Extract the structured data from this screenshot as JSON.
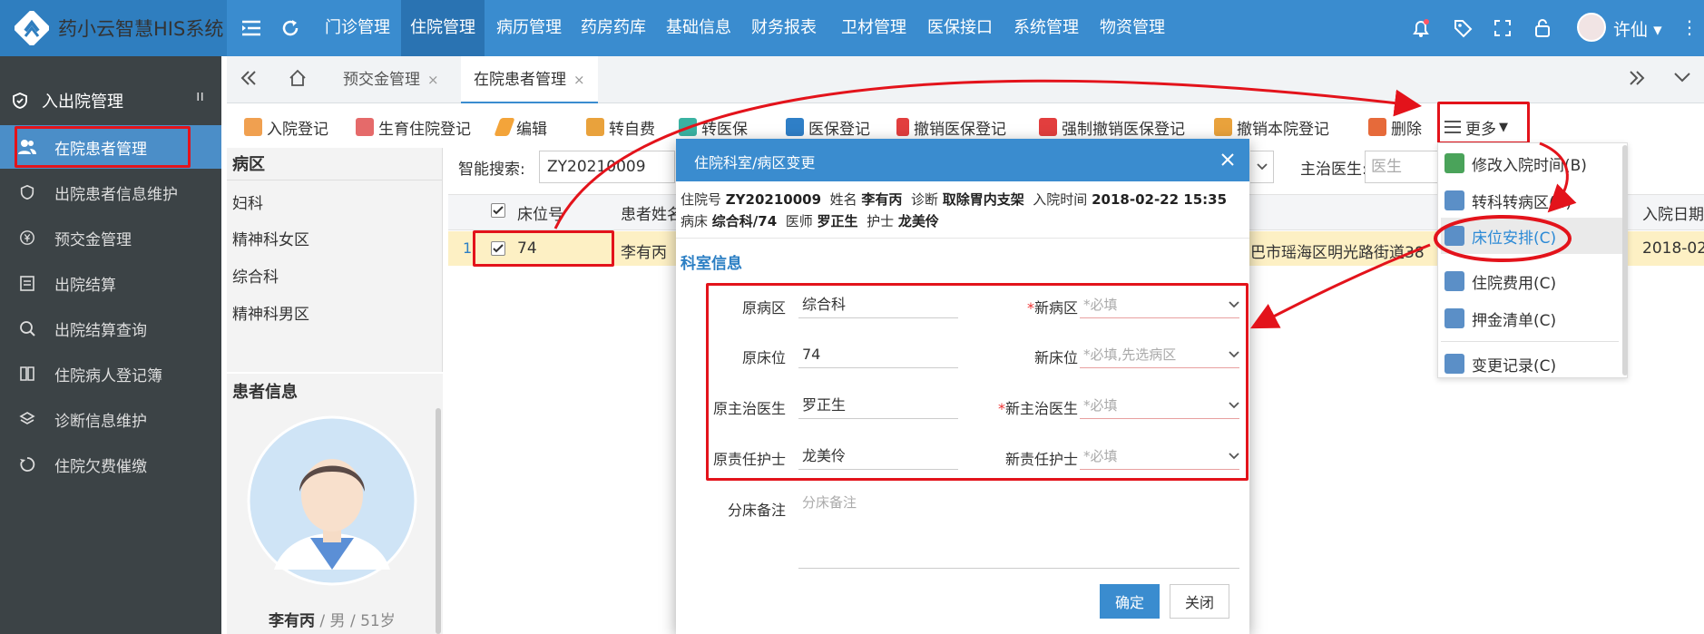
{
  "app": {
    "title": "药小云智慧HIS系统"
  },
  "nav": [
    "门诊管理",
    "住院管理",
    "病历管理",
    "药房药库",
    "基础信息",
    "财务报表",
    "卫材管理",
    "医保接口",
    "系统管理",
    "物资管理"
  ],
  "user": {
    "name": "许仙"
  },
  "sidebar": {
    "group": "入出院管理",
    "items": [
      "在院患者管理",
      "出院患者信息维护",
      "预交金管理",
      "出院结算",
      "出院结算查询",
      "住院病人登记簿",
      "诊断信息维护",
      "住院欠费催缴"
    ]
  },
  "tabs": [
    {
      "label": "预交金管理",
      "close": "×"
    },
    {
      "label": "在院患者管理",
      "close": "×"
    }
  ],
  "toolbar": [
    "入院登记",
    "生育住院登记",
    "编辑",
    "转自费",
    "转医保",
    "医保登记",
    "撤销医保登记",
    "强制撤销医保登记",
    "撤销本院登记",
    "删除",
    "更多"
  ],
  "ward": {
    "header": "病区",
    "items": [
      "妇科",
      "精神科女区",
      "综合科",
      "精神科男区"
    ]
  },
  "patient": {
    "header": "患者信息",
    "name": "李有丙",
    "sep1": " / ",
    "gender": "男",
    "sep2": " / ",
    "age": "51岁"
  },
  "search": {
    "label": "智能搜索:",
    "value": "ZY20210009",
    "doctor_label": "主治医生:",
    "doctor_placeholder": "医生"
  },
  "grid": {
    "headers": {
      "bed": "床位号",
      "name": "患者姓名",
      "admit": "入院日期"
    },
    "row": {
      "index": "1",
      "bed": "74",
      "name": "李有丙",
      "address": "巴市瑶海区明光路街道38",
      "admit": "2018-02-"
    }
  },
  "more_menu": [
    "修改入院时间(B)",
    "转科转病区(C)",
    "床位安排(C)",
    "住院费用(C)",
    "押金清单(C)",
    "变更记录(C)"
  ],
  "modal": {
    "title": "住院科室/病区变更",
    "info": {
      "l_no": "住院号",
      "no": "ZY20210009",
      "l_name": "姓名",
      "name": "李有丙",
      "l_diag": "诊断",
      "diag": "取除胃内支架",
      "l_time": "入院时间",
      "time": "2018-02-22 15:35",
      "l_bed": "病床",
      "bed": "综合科/74",
      "l_doc": "医师",
      "doc": "罗正生",
      "l_nurse": "护士",
      "nurse": "龙美伶"
    },
    "section": "科室信息",
    "fields": {
      "old_ward_label": "原病区",
      "old_ward": "综合科",
      "new_ward_label": "新病区",
      "new_ward_ph": "*必填",
      "old_bed_label": "原床位",
      "old_bed": "74",
      "new_bed_label": "新床位",
      "new_bed_ph": "*必填,先选病区",
      "old_doc_label": "原主治医生",
      "old_doc": "罗正生",
      "new_doc_label": "新主治医生",
      "new_doc_ph": "*必填",
      "old_nurse_label": "原责任护士",
      "old_nurse": "龙美伶",
      "new_nurse_label": "新责任护士",
      "new_nurse_ph": "*必填"
    },
    "remark_label": "分床备注",
    "remark_ph": "分床备注",
    "ok": "确定",
    "close": "关闭"
  },
  "colors": {
    "primary": "#3a8ccf",
    "sidebar": "#3c4346",
    "highlight_row": "#fdf0c4",
    "annotation": "#e3131b"
  }
}
